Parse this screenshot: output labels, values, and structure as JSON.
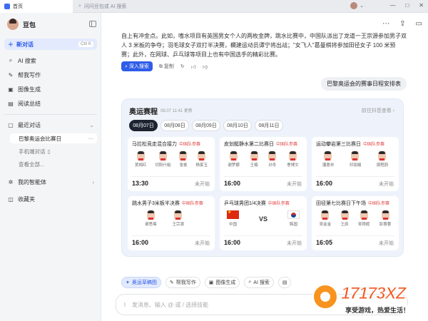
{
  "browser": {
    "tab_title": "首页",
    "address_placeholder": "问问豆包或 AI 搜索",
    "controls": [
      "—",
      "□",
      "✕"
    ]
  },
  "sidebar": {
    "brand": "豆包",
    "new_chat": "新对话",
    "new_chat_shortcut": "Ctrl K",
    "items": [
      {
        "icon": "search-icon",
        "glyph": "⌕",
        "label": "AI 搜索"
      },
      {
        "icon": "pen-icon",
        "glyph": "✎",
        "label": "帮我写作"
      },
      {
        "icon": "image-icon",
        "glyph": "▣",
        "label": "图像生成"
      },
      {
        "icon": "book-icon",
        "glyph": "▤",
        "label": "阅读总结"
      }
    ],
    "recent_label": "最近对话",
    "recent": [
      {
        "label": "巴黎奥运会比赛日"
      },
      {
        "label": "手机端对话"
      },
      {
        "label": "查看全部..."
      }
    ],
    "agents_label": "我的智能体",
    "favorites_label": "收藏夹"
  },
  "main": {
    "paragraph": "自上有冲金点。此如，嗜水项目有英国男女个人的两枚金牌，跳水比赛中，中国队派出了龙道一王宗源参加男子双人 3 米板的争夺；羽毛球女子双打半决赛，欄建运动员谭宁将出战；\"女飞人\"葛曼棋将参加田径女子 100 米预赛；此外，在网球、乒乓球等项目上也有中国选手的精彩比赛。",
    "deep_search": "深入搜索",
    "copy": "复制",
    "user_message": "巴黎奥运会的赛事日程安排表"
  },
  "schedule": {
    "title": "奥运赛程",
    "update": "08.07 11:41 更新",
    "link": "前往抖音查看",
    "dates": [
      "08月07日",
      "08月08日",
      "08月09日",
      "08月10日",
      "08月11日"
    ],
    "selected_date": "08月07日",
    "events": [
      {
        "name": "马拉松竞走混合接力",
        "tag": "中国队参赛",
        "athletes": [
          "贺相红",
          "切阳什姐",
          "张俊",
          "杨家玉"
        ],
        "time": "13:30",
        "status": "未开始"
      },
      {
        "name": "皮划艇静水第二比赛日",
        "tag": "中国队参赛",
        "athletes": [
          "谢罗娜",
          "王楠",
          "孙冬",
          "季博文"
        ],
        "time": "16:00",
        "status": "未开始"
      },
      {
        "name": "运动攀岩第三比赛日",
        "tag": "中国队参赛",
        "athletes": [
          "潘愚非",
          "邓丽娟",
          "周程蔚"
        ],
        "time": "16:00",
        "status": "未开始"
      },
      {
        "name": "跳水男子3米板半决赛",
        "tag": "中国队参赛",
        "athletes": [
          "谢思埸",
          "王宗源"
        ],
        "time": "16:00",
        "status": "未开始"
      },
      {
        "name": "乒乓球男团1/4决赛",
        "tag": "中国队参赛",
        "team_a": "中国",
        "team_b": "韩国",
        "vs": "VS",
        "time": "16:00",
        "status": "未开始"
      },
      {
        "name": "田径第七比赛日下午场",
        "tag": "中国队参赛",
        "athletes": [
          "吴金金",
          "王辰",
          "吴艳妮",
          "彭蓉蓉"
        ],
        "time": "16:05",
        "status": "未开始"
      }
    ]
  },
  "toolbar": {
    "tools": [
      {
        "icon": "sparkle-icon",
        "glyph": "✦",
        "label": "奥运草稿图",
        "selected": true
      },
      {
        "icon": "pen-icon",
        "glyph": "✎",
        "label": "帮我写作",
        "selected": false
      },
      {
        "icon": "image-icon",
        "glyph": "▣",
        "label": "图像生成",
        "selected": false
      },
      {
        "icon": "search-icon",
        "glyph": "⌕",
        "label": "AI 搜索",
        "selected": false
      },
      {
        "icon": "document-icon",
        "glyph": "▤",
        "label": "",
        "selected": false
      }
    ],
    "input_placeholder": "发消息、输入 @ 或 / 选择技能"
  },
  "watermark": {
    "brand": "17173",
    "suffix": "XZ",
    "slogan": "享受游戏，热爱生活！"
  },
  "colors": {
    "accent": "#2f5de8",
    "tag_red": "#e04848",
    "selected_date_bg": "#1d2330"
  }
}
